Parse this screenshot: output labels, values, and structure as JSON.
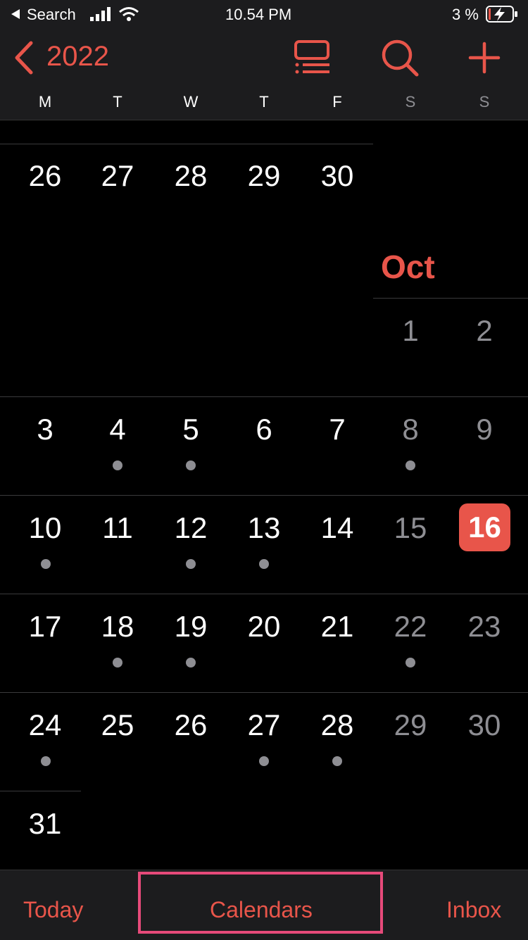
{
  "status_bar": {
    "back_label": "Search",
    "time": "10.54 PM",
    "battery": "3 %"
  },
  "header": {
    "year": "2022",
    "weekdays": [
      "M",
      "T",
      "W",
      "T",
      "F",
      "S",
      "S"
    ]
  },
  "calendar": {
    "prev_month_row": [
      "26",
      "27",
      "28",
      "29",
      "30"
    ],
    "month_name": "Oct",
    "week1": [
      "1",
      "2"
    ],
    "week2": [
      "3",
      "4",
      "5",
      "6",
      "7",
      "8",
      "9"
    ],
    "week3": [
      "10",
      "11",
      "12",
      "13",
      "14",
      "15",
      "16"
    ],
    "week4": [
      "17",
      "18",
      "19",
      "20",
      "21",
      "22",
      "23"
    ],
    "week5": [
      "24",
      "25",
      "26",
      "27",
      "28",
      "29",
      "30"
    ],
    "week6": [
      "31"
    ],
    "today": "16"
  },
  "tab_bar": {
    "today_label": "Today",
    "calendars_label": "Calendars",
    "inbox_label": "Inbox"
  },
  "colors": {
    "accent": "#e8554a",
    "highlight_box": "#e64a7a"
  },
  "icons": [
    "back-triangle-icon",
    "signal-icon",
    "wifi-icon",
    "battery-charging-icon",
    "chevron-left-icon",
    "list-view-icon",
    "search-icon",
    "plus-icon"
  ]
}
